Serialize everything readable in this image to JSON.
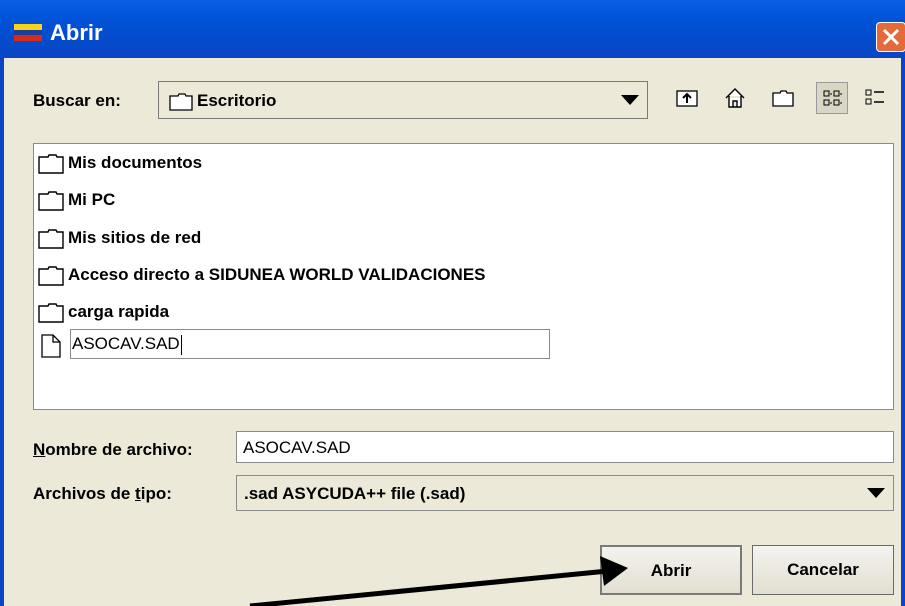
{
  "window": {
    "title": "Abrir"
  },
  "lookin": {
    "label": "Buscar en:",
    "value": "Escritorio"
  },
  "toolbar": {
    "icons": [
      "up-folder-icon",
      "home-icon",
      "new-folder-icon",
      "list-view-icon",
      "details-view-icon"
    ]
  },
  "files": {
    "items": [
      {
        "name": "Mis documentos",
        "icon": "folder-icon"
      },
      {
        "name": "Mi PC",
        "icon": "folder-icon"
      },
      {
        "name": "Mis sitios de red",
        "icon": "folder-icon"
      },
      {
        "name": "Acceso directo a SIDUNEA WORLD VALIDACIONES",
        "icon": "folder-icon"
      },
      {
        "name": "carga rapida",
        "icon": "folder-icon"
      }
    ],
    "editing": {
      "name": "ASOCAV.SAD",
      "icon": "file-icon"
    }
  },
  "filename": {
    "label_underlined": "N",
    "label_rest": "ombre de archivo:",
    "value": "ASOCAV.SAD"
  },
  "filetype": {
    "label_pre": "Archivos de ",
    "label_underlined": "t",
    "label_post": "ipo:",
    "value": ".sad ASYCUDA++ file (.sad)"
  },
  "buttons": {
    "open": "Abrir",
    "cancel": "Cancelar"
  },
  "colors": {
    "titlebar": "#0a5fe6",
    "dialog_bg": "#ece9d8",
    "close": "#e26a3b"
  }
}
